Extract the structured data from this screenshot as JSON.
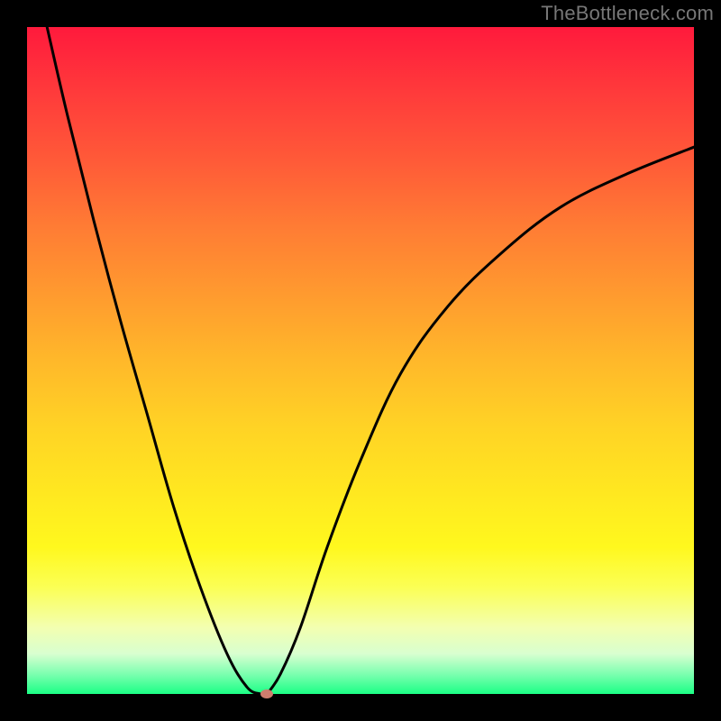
{
  "watermark": "TheBottleneck.com",
  "chart_data": {
    "type": "line",
    "title": "",
    "xlabel": "",
    "ylabel": "",
    "xlim": [
      0,
      100
    ],
    "ylim": [
      0,
      100
    ],
    "grid": false,
    "legend": false,
    "series": [
      {
        "name": "left-branch",
        "x": [
          3,
          6,
          10,
          14,
          18,
          22,
          26,
          30,
          33,
          35
        ],
        "y": [
          100,
          87,
          71,
          56,
          42,
          28,
          16,
          6,
          1,
          0
        ]
      },
      {
        "name": "right-branch",
        "x": [
          36,
          38,
          41,
          45,
          50,
          56,
          63,
          71,
          80,
          90,
          100
        ],
        "y": [
          0,
          3,
          10,
          22,
          35,
          48,
          58,
          66,
          73,
          78,
          82
        ]
      }
    ],
    "marker": {
      "x": 36,
      "y": 0
    },
    "background_gradient": {
      "top": "#ff1a3c",
      "mid": "#ffe820",
      "bottom": "#1bff85"
    },
    "curve_color": "#000000",
    "marker_color": "#cf7d6e"
  }
}
